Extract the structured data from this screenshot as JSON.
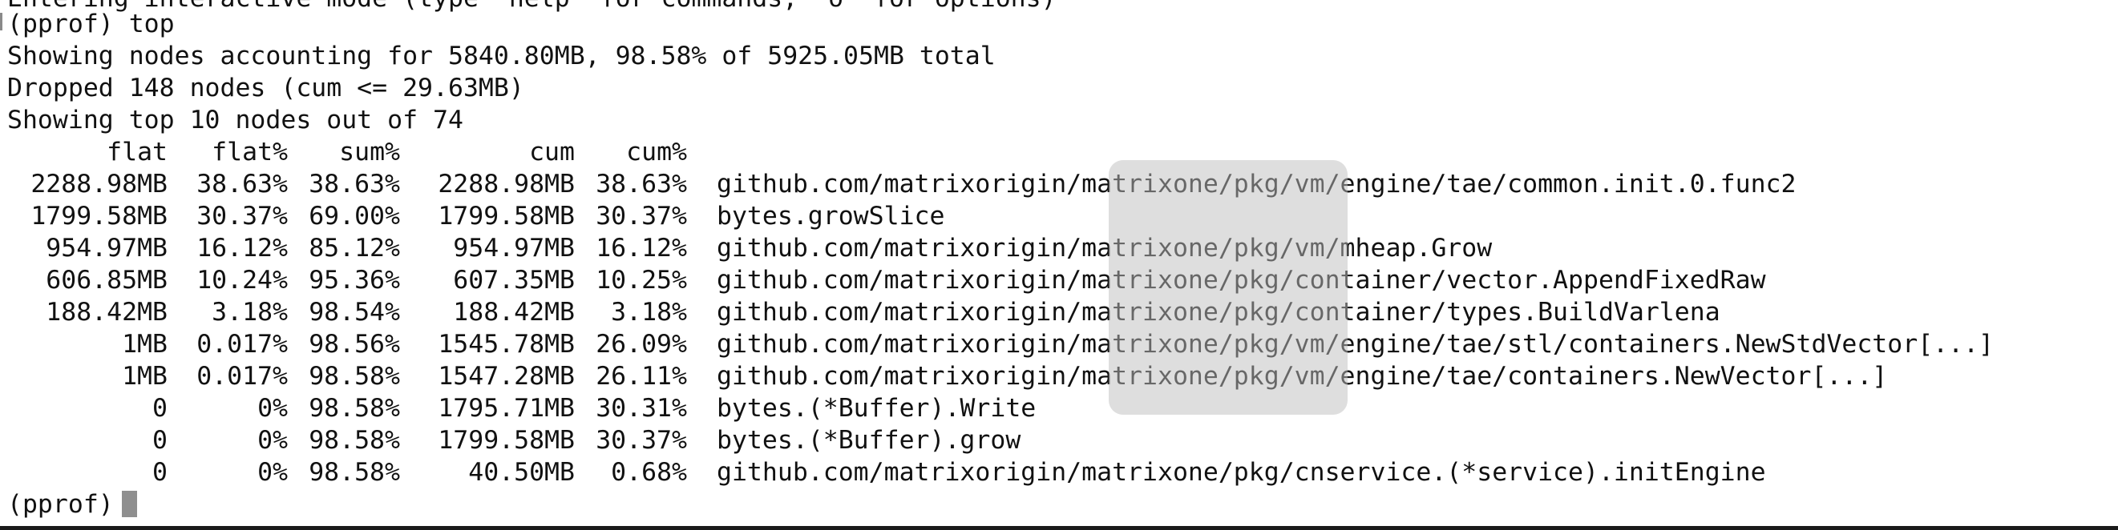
{
  "terminal": {
    "cut_line": "Entering interactive mode (type \"help\" for commands, \"o\" for options)",
    "prompt_top": "(pprof) top",
    "summary1": "Showing nodes accounting for 5840.80MB, 98.58% of 5925.05MB total",
    "summary2": "Dropped 148 nodes (cum <= 29.63MB)",
    "summary3": "Showing top 10 nodes out of 74",
    "headers": {
      "flat": "flat",
      "flat_pct": "flat%",
      "sum_pct": "sum%",
      "cum": "cum",
      "cum_pct": "cum%"
    },
    "rows": [
      {
        "flat": "2288.98MB",
        "flat_pct": "38.63%",
        "sum_pct": "38.63%",
        "cum": "2288.98MB",
        "cum_pct": "38.63%",
        "name": "github.com/matrixorigin/matrixone/pkg/vm/engine/tae/common.init.0.func2"
      },
      {
        "flat": "1799.58MB",
        "flat_pct": "30.37%",
        "sum_pct": "69.00%",
        "cum": "1799.58MB",
        "cum_pct": "30.37%",
        "name": "bytes.growSlice"
      },
      {
        "flat": "954.97MB",
        "flat_pct": "16.12%",
        "sum_pct": "85.12%",
        "cum": "954.97MB",
        "cum_pct": "16.12%",
        "name": "github.com/matrixorigin/matrixone/pkg/vm/mheap.Grow"
      },
      {
        "flat": "606.85MB",
        "flat_pct": "10.24%",
        "sum_pct": "95.36%",
        "cum": "607.35MB",
        "cum_pct": "10.25%",
        "name": "github.com/matrixorigin/matrixone/pkg/container/vector.AppendFixedRaw"
      },
      {
        "flat": "188.42MB",
        "flat_pct": "3.18%",
        "sum_pct": "98.54%",
        "cum": "188.42MB",
        "cum_pct": "3.18%",
        "name": "github.com/matrixorigin/matrixone/pkg/container/types.BuildVarlena"
      },
      {
        "flat": "1MB",
        "flat_pct": "0.017%",
        "sum_pct": "98.56%",
        "cum": "1545.78MB",
        "cum_pct": "26.09%",
        "name": "github.com/matrixorigin/matrixone/pkg/vm/engine/tae/stl/containers.NewStdVector[...]"
      },
      {
        "flat": "1MB",
        "flat_pct": "0.017%",
        "sum_pct": "98.58%",
        "cum": "1547.28MB",
        "cum_pct": "26.11%",
        "name": "github.com/matrixorigin/matrixone/pkg/vm/engine/tae/containers.NewVector[...]"
      },
      {
        "flat": "0",
        "flat_pct": "0%",
        "sum_pct": "98.58%",
        "cum": "1795.71MB",
        "cum_pct": "30.31%",
        "name": "bytes.(*Buffer).Write"
      },
      {
        "flat": "0",
        "flat_pct": "0%",
        "sum_pct": "98.58%",
        "cum": "1799.58MB",
        "cum_pct": "30.37%",
        "name": "bytes.(*Buffer).grow"
      },
      {
        "flat": "0",
        "flat_pct": "0%",
        "sum_pct": "98.58%",
        "cum": "40.50MB",
        "cum_pct": "0.68%",
        "name": "github.com/matrixorigin/matrixone/pkg/cnservice.(*service).initEngine"
      }
    ],
    "prompt_bottom": "(pprof)"
  }
}
